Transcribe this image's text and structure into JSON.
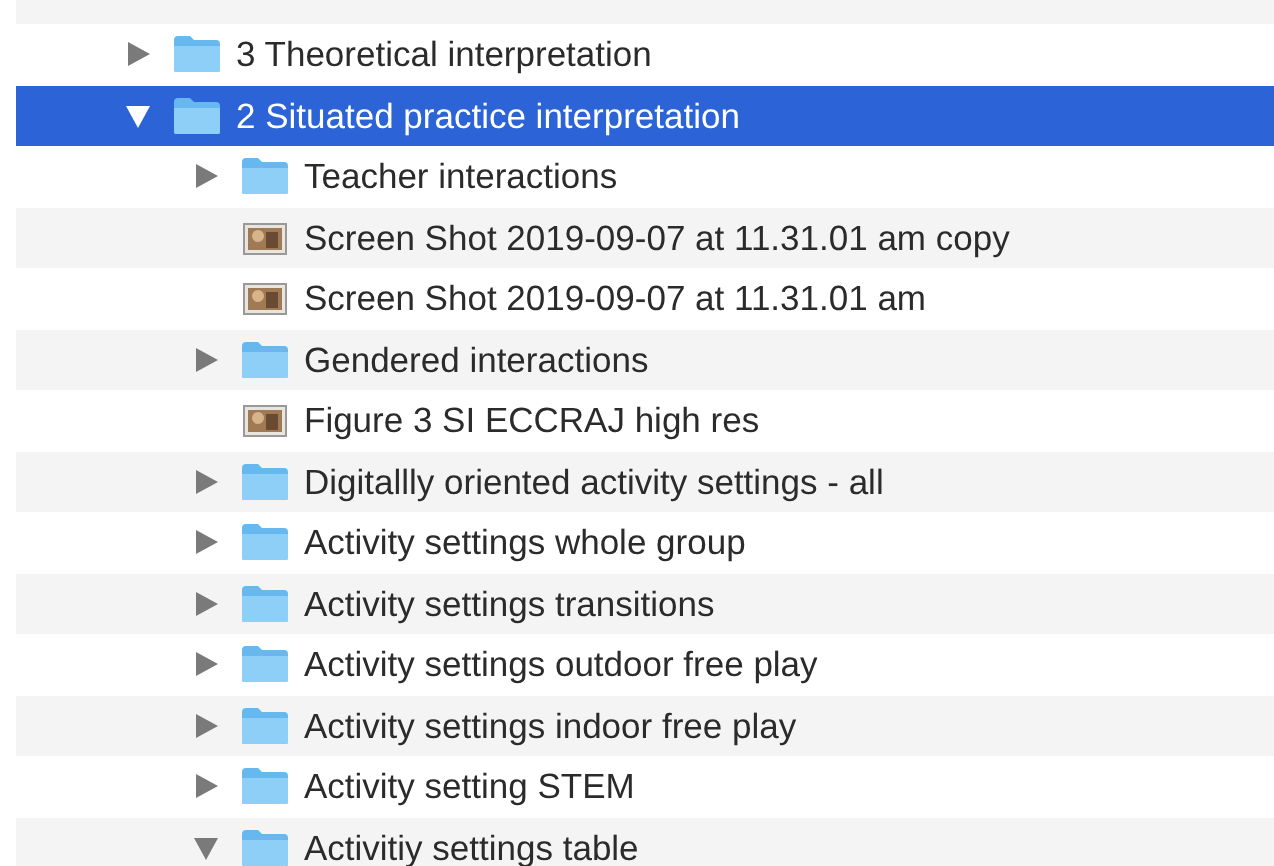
{
  "items": [
    {
      "kind": "folder",
      "name": "3 Theoretical interpretation",
      "expanded": false,
      "selected": false
    },
    {
      "kind": "folder",
      "name": "2 Situated practice interpretation",
      "expanded": true,
      "selected": true,
      "children": [
        {
          "kind": "folder",
          "name": "Teacher interactions",
          "expanded": false,
          "selected": false
        },
        {
          "kind": "image",
          "name": "Screen Shot 2019-09-07 at 11.31.01 am copy",
          "selected": false
        },
        {
          "kind": "image",
          "name": "Screen Shot 2019-09-07 at 11.31.01 am",
          "selected": false
        },
        {
          "kind": "folder",
          "name": "Gendered interactions",
          "expanded": false,
          "selected": false
        },
        {
          "kind": "image",
          "name": "Figure 3 SI ECCRAJ high res",
          "selected": false
        },
        {
          "kind": "folder",
          "name": "Digitallly oriented activity settings - all",
          "expanded": false,
          "selected": false
        },
        {
          "kind": "folder",
          "name": "Activity settings whole group",
          "expanded": false,
          "selected": false
        },
        {
          "kind": "folder",
          "name": "Activity settings transitions",
          "expanded": false,
          "selected": false
        },
        {
          "kind": "folder",
          "name": "Activity settings outdoor free play",
          "expanded": false,
          "selected": false
        },
        {
          "kind": "folder",
          "name": "Activity settings indoor free play",
          "expanded": false,
          "selected": false
        },
        {
          "kind": "folder",
          "name": "Activity setting STEM",
          "expanded": false,
          "selected": false
        },
        {
          "kind": "folder",
          "name": "Activitiy settings table",
          "expanded": true,
          "selected": false
        }
      ]
    }
  ]
}
